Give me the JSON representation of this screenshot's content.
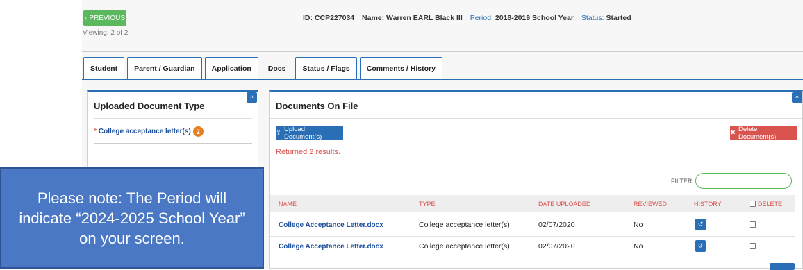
{
  "header": {
    "prev_label": "PREVIOUS",
    "viewing": "Viewing: 2 of 2",
    "id_text": "ID: CCP227034",
    "name_text": "Name: Warren EARL Black III",
    "period_label": "Period:",
    "period_value": "2018-2019 School Year",
    "status_label": "Status:",
    "status_value": "Started"
  },
  "tabs": [
    {
      "label": "Student"
    },
    {
      "label": "Parent / Guardian"
    },
    {
      "label": "Application"
    },
    {
      "label": "Docs"
    },
    {
      "label": "Status / Flags"
    },
    {
      "label": "Comments / History"
    }
  ],
  "active_tab": "Docs",
  "left_panel": {
    "title": "Uploaded Document Type",
    "item_label": "College acceptance letter(s)",
    "item_required_mark": "*",
    "item_count": "2"
  },
  "right_panel": {
    "title": "Documents On File",
    "upload_label": "Upload Document(s)",
    "delete_label": "Delete Document(s)",
    "results_text": "Returned 2 results.",
    "filter_label": "FILTER:",
    "filter_value": ""
  },
  "table": {
    "columns": [
      "NAME",
      "TYPE",
      "DATE UPLOADED",
      "REVIEWED",
      "HISTORY",
      "DELETE"
    ],
    "rows": [
      {
        "name": "College Acceptance Letter.docx",
        "type": "College acceptance letter(s)",
        "date": "02/07/2020",
        "reviewed": "No"
      },
      {
        "name": "College Acceptance Letter.docx",
        "type": "College acceptance letter(s)",
        "date": "02/07/2020",
        "reviewed": "No"
      }
    ]
  },
  "note": {
    "text": "Please note: The Period will indicate “2024-2025 School Year” on your screen."
  },
  "colors": {
    "primary": "#2a6fb5",
    "success": "#5cb85c",
    "danger": "#d9534f",
    "badge": "#e67e22",
    "note_bg": "#4a78c4"
  }
}
